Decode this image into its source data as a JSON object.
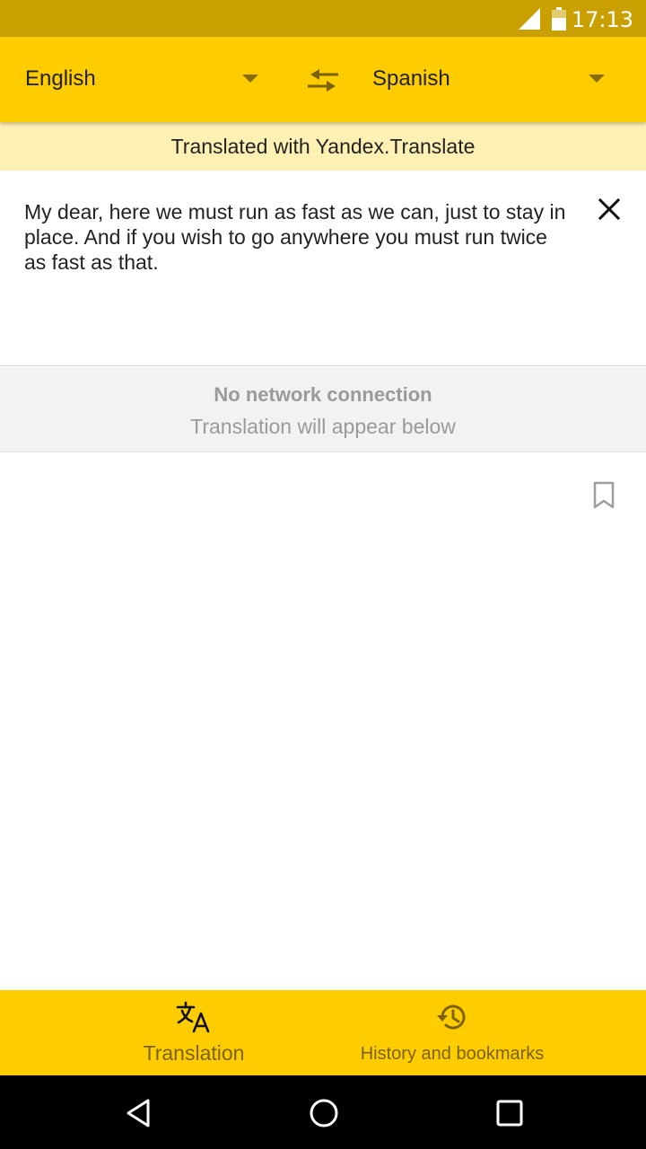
{
  "status_bar": {
    "time": "17:13",
    "icons": [
      "signal-icon",
      "battery-icon"
    ]
  },
  "toolbar": {
    "source_language": "English",
    "target_language": "Spanish",
    "swap_icon": "swap-languages-icon"
  },
  "attribution": "Translated with Yandex.Translate",
  "input": {
    "text": "My dear, here we must run as fast as we can, just to stay in place. And if you wish to go anywhere you must run twice as fast as that.",
    "clear_icon": "close-icon"
  },
  "network_banner": {
    "title": "No network connection",
    "subtitle": "Translation will appear below"
  },
  "result": {
    "bookmark_icon": "bookmark-icon"
  },
  "bottom_nav": {
    "tabs": [
      {
        "label": "Translation",
        "icon": "translate-icon",
        "active": true
      },
      {
        "label": "History and bookmarks",
        "icon": "history-icon",
        "active": false
      }
    ]
  },
  "system_nav": {
    "buttons": [
      "back-icon",
      "home-icon",
      "recents-icon"
    ]
  },
  "colors": {
    "status_bar": "#c9a000",
    "toolbar": "#ffcc00",
    "attribution_bg": "#fff0b3",
    "muted_text": "#9a9a9a",
    "nav_label": "#7a6200"
  }
}
